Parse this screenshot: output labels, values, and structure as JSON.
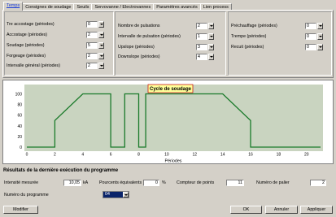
{
  "tabs": [
    "Temps",
    "Consignes de soudage",
    "Seuils",
    "Servovanne / Electrovannes",
    "Paramètres avancés",
    "Lien process"
  ],
  "group1": {
    "rows": [
      {
        "label": "Tre accostage (périodes)",
        "value": "0"
      },
      {
        "label": "Accostage (périodes)",
        "value": "2"
      },
      {
        "label": "Soudage (périodes)",
        "value": "5"
      },
      {
        "label": "Forgeage (périodes)",
        "value": "2"
      },
      {
        "label": "Intervalle général (périodes)",
        "value": "2"
      }
    ]
  },
  "group2": {
    "rows": [
      {
        "label": "Nombre de pulsations",
        "value": "2"
      },
      {
        "label": "Intervalle de pulsation (périodes)",
        "value": "1"
      },
      {
        "label": "Upslope (périodes)",
        "value": "3"
      },
      {
        "label": "Downslope (périodes)",
        "value": "4"
      }
    ]
  },
  "group3": {
    "rows": [
      {
        "label": "Préchauffage (périodes)",
        "value": "0"
      },
      {
        "label": "Trempe (périodes)",
        "value": "0"
      },
      {
        "label": "Recuit (périodes)",
        "value": "0"
      }
    ]
  },
  "chart_data": {
    "type": "line",
    "title": "Cycle de soudage",
    "xlabel": "Périodes",
    "ylabel": "",
    "xlim": [
      0,
      21
    ],
    "ylim": [
      0,
      110
    ],
    "xticks": [
      0,
      2,
      4,
      6,
      8,
      10,
      12,
      14,
      16,
      18,
      20
    ],
    "yticks": [
      0,
      20,
      40,
      60,
      80,
      100
    ],
    "grid": false,
    "line_color": "#1a7a2a",
    "plot_bg": "#c9d4c0",
    "points": [
      [
        0,
        0
      ],
      [
        2,
        0
      ],
      [
        2,
        50
      ],
      [
        4,
        100
      ],
      [
        6,
        100
      ],
      [
        6,
        0
      ],
      [
        7,
        0
      ],
      [
        7,
        100
      ],
      [
        8,
        100
      ],
      [
        8,
        0
      ],
      [
        8.5,
        0
      ],
      [
        8.5,
        100
      ],
      [
        14,
        100
      ],
      [
        16,
        50
      ],
      [
        16,
        0
      ],
      [
        21,
        0
      ]
    ]
  },
  "results": {
    "title": "Résultats de la dernière exécution du programme",
    "intensity_label": "Intensité mesurée",
    "intensity_value": "10,05",
    "intensity_unit": "kA",
    "equiv_label": "Pourcents équivalents",
    "equiv_value": "0",
    "equiv_unit": "%",
    "points_label": "Compteur de points",
    "points_value": "11",
    "step_label": "Numéro de palier",
    "step_value": "2",
    "program_label": "Numéro du programme",
    "program_value": "04"
  },
  "buttons": {
    "modify": "Modifier",
    "ok": "OK",
    "cancel": "Annuler",
    "apply": "Appliquer"
  }
}
